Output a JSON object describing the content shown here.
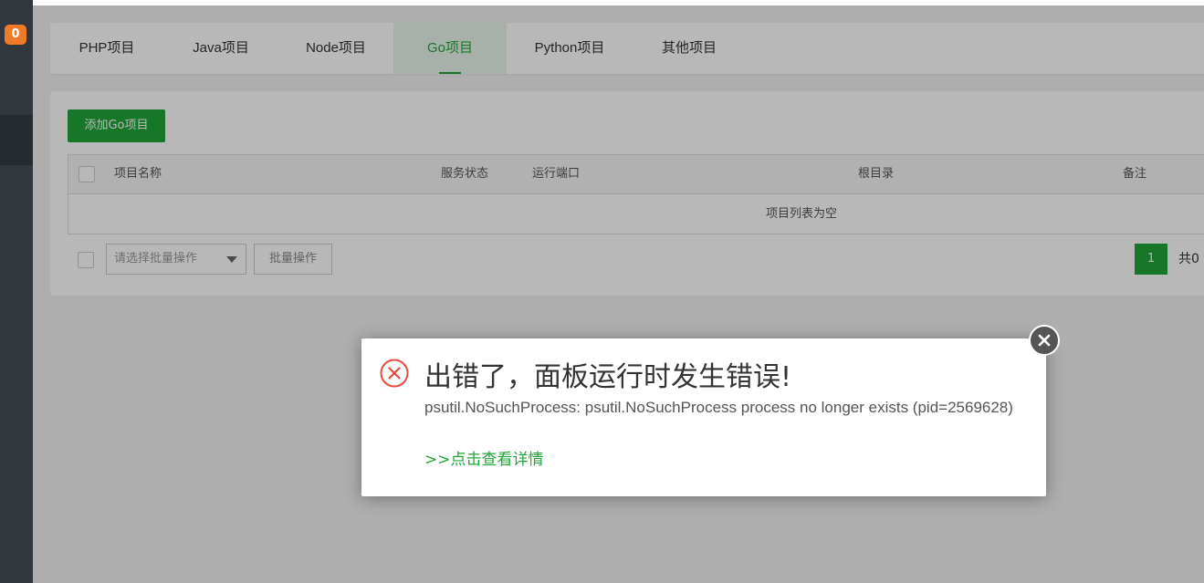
{
  "sidebar": {
    "notification_count": "0"
  },
  "tabs": [
    {
      "label": "PHP项目"
    },
    {
      "label": "Java项目"
    },
    {
      "label": "Node项目"
    },
    {
      "label": "Go项目",
      "active": true
    },
    {
      "label": "Python项目"
    },
    {
      "label": "其他项目"
    }
  ],
  "toolbar": {
    "add_button": "添加Go项目"
  },
  "table": {
    "columns": [
      "项目名称",
      "服务状态",
      "运行端口",
      "根目录",
      "备注"
    ],
    "empty_text": "项目列表为空"
  },
  "footer": {
    "batch_select_placeholder": "请选择批量操作",
    "batch_button": "批量操作",
    "current_page": "1",
    "total_text": "共0"
  },
  "dialog": {
    "title": "出错了，面板运行时发生错误!",
    "message": "psutil.NoSuchProcess: psutil.NoSuchProcess process no longer exists (pid=2569628)",
    "detail_link": ">>点击查看详情"
  },
  "colors": {
    "accent": "#20a53a",
    "error": "#e74c3c",
    "badge": "#f07a27",
    "sidebar": "#31373d"
  }
}
